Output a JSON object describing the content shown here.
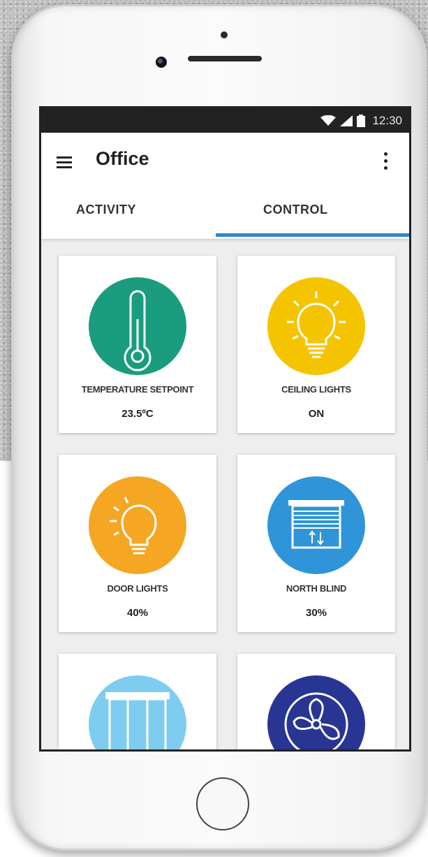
{
  "status_bar": {
    "time": "12:30",
    "icons": [
      "wifi-icon",
      "signal-icon",
      "battery-icon"
    ]
  },
  "app_bar": {
    "title": "Office",
    "menu_icon": "menu-icon",
    "more_icon": "more-vert-icon"
  },
  "tabs": [
    {
      "label": "ACTIVITY",
      "active": false
    },
    {
      "label": "CONTROL",
      "active": true
    }
  ],
  "colors": {
    "tab_indicator": "#2f86c9",
    "temperature": "#1a9c7e",
    "ceiling_lights": "#f5c400",
    "door_lights": "#f5a623",
    "north_blind": "#2f95d8",
    "window_blind": "#7ecdf0",
    "fan": "#283593"
  },
  "cards": [
    {
      "label": "TEMPERATURE SETPOINT",
      "value": "23.5ºC",
      "icon": "thermometer-icon"
    },
    {
      "label": "CEILING LIGHTS",
      "value": "ON",
      "icon": "lightbulb-icon"
    },
    {
      "label": "DOOR LIGHTS",
      "value": "40%",
      "icon": "lightbulb-icon"
    },
    {
      "label": "NORTH BLIND",
      "value": "30%",
      "icon": "blind-icon"
    },
    {
      "label": "",
      "value": "",
      "icon": "window-blind-icon"
    },
    {
      "label": "",
      "value": "",
      "icon": "fan-icon"
    }
  ]
}
